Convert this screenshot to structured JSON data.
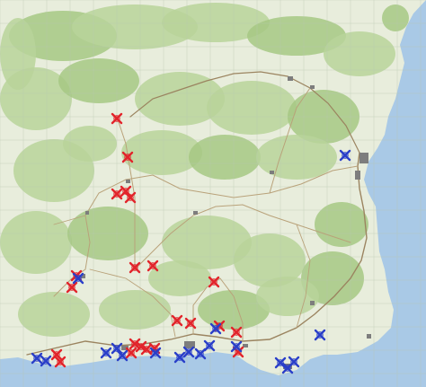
{
  "map": {
    "colors": {
      "land": "#e8eddc",
      "forest": "#b9d49a",
      "forest_dark": "#a6c884",
      "sea": "#a9c9e6",
      "sea_deep": "#8fb7dd",
      "road": "#b9a27a",
      "road_main": "#9b8460",
      "grid": "#b7c7b0",
      "town": "#7d7d7d",
      "red_marker": "#e2242b",
      "blue_marker": "#2a3fc9"
    },
    "marker_types": [
      "red-x-marker",
      "blue-x-marker"
    ]
  }
}
